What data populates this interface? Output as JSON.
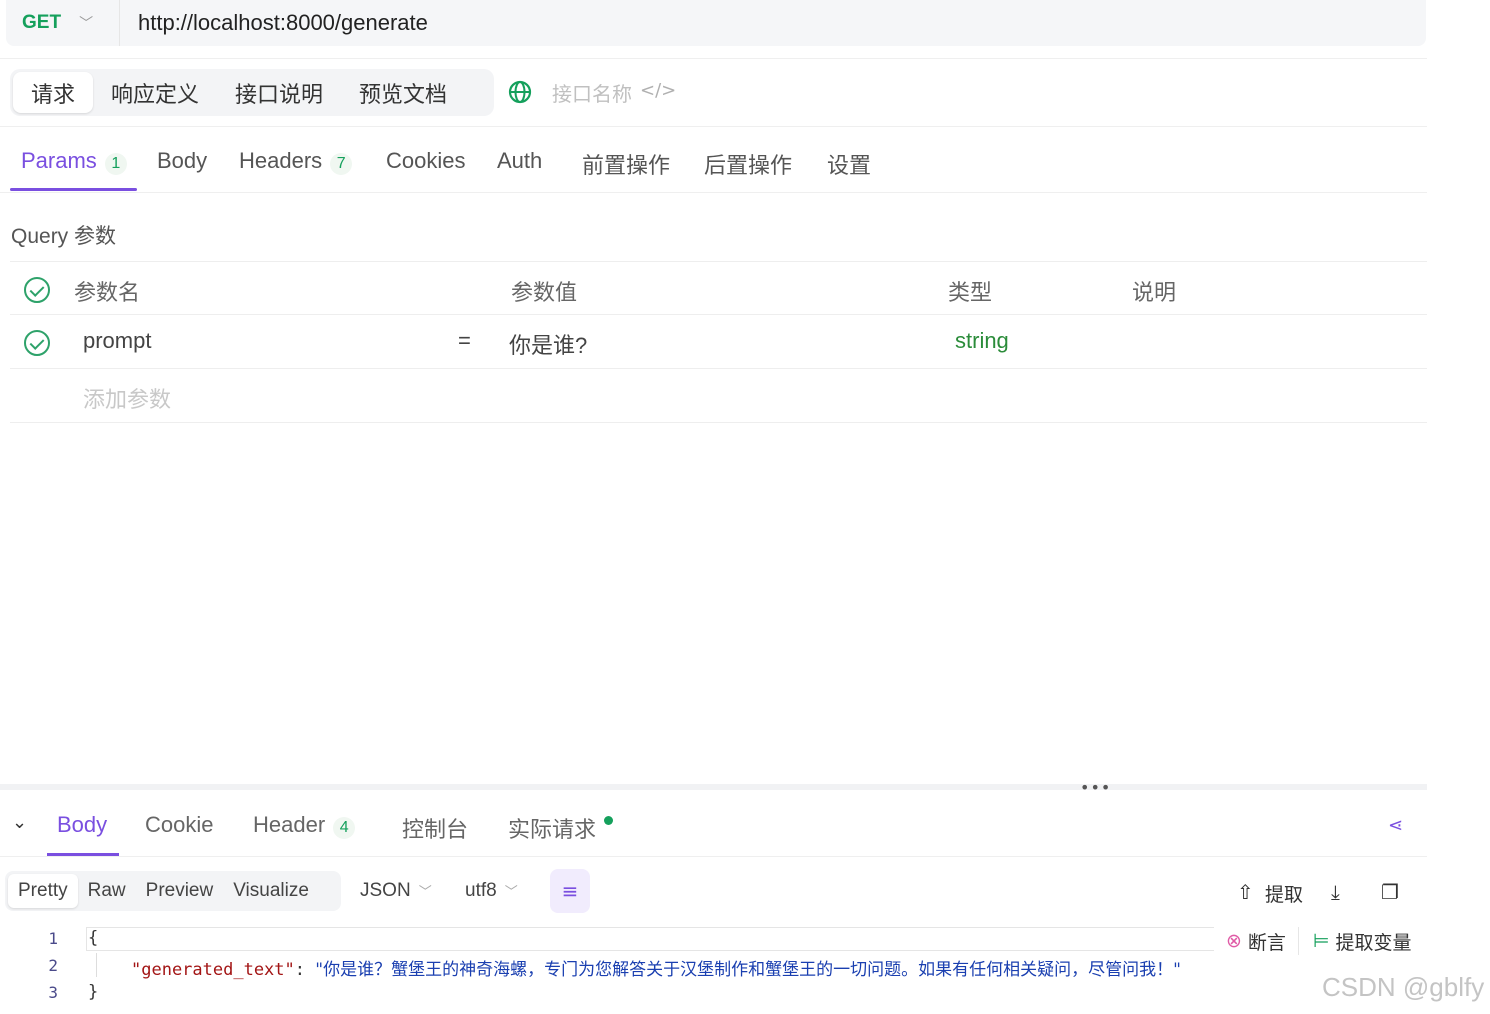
{
  "request": {
    "method": "GET",
    "url": "http://localhost:8000/generate"
  },
  "top_tabs": [
    "请求",
    "响应定义",
    "接口说明",
    "预览文档"
  ],
  "interface_name_placeholder": "接口名称",
  "request_tabs": [
    {
      "label": "Params",
      "badge": "1"
    },
    {
      "label": "Body"
    },
    {
      "label": "Headers",
      "badge": "7"
    },
    {
      "label": "Cookies"
    },
    {
      "label": "Auth"
    },
    {
      "label": "前置操作"
    },
    {
      "label": "后置操作"
    },
    {
      "label": "设置"
    }
  ],
  "query_title": "Query 参数",
  "params_table": {
    "headers": [
      "参数名",
      "参数值",
      "类型",
      "说明"
    ],
    "rows": [
      {
        "name": "prompt",
        "eq": "=",
        "value": "你是谁?",
        "type": "string",
        "desc": ""
      }
    ],
    "add_placeholder": "添加参数"
  },
  "response_tabs": [
    {
      "label": "Body"
    },
    {
      "label": "Cookie"
    },
    {
      "label": "Header",
      "badge": "4"
    },
    {
      "label": "控制台"
    },
    {
      "label": "实际请求"
    }
  ],
  "view_modes": [
    "Pretty",
    "Raw",
    "Preview",
    "Visualize"
  ],
  "format_select": "JSON",
  "encoding_select": "utf8",
  "tools": {
    "extract": "提取",
    "assert": "断言",
    "extract_var": "提取变量"
  },
  "code": {
    "line_numbers": [
      "1",
      "2",
      "3"
    ],
    "open": "{",
    "key": "\"generated_text\"",
    "colon": ": ",
    "value": "\"你是谁？蟹堡王的神奇海螺，专门为您解答关于汉堡制作和蟹堡王的一切问题。如果有任何相关疑问，尽管问我！\"",
    "close": "}"
  },
  "watermark": "CSDN @gblfy",
  "colors": {
    "accent": "#7a4fe0",
    "method_green": "#15a05c",
    "type_green": "#2b8c3a"
  }
}
